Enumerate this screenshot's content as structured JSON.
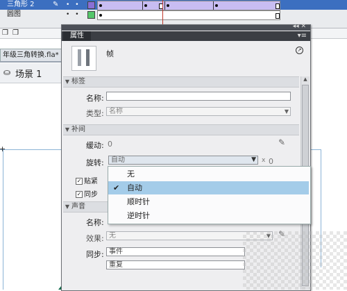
{
  "timeline": {
    "layers": [
      {
        "name": "三角形 2",
        "color": "#8a6fd6",
        "selected": true
      },
      {
        "name": "圆图",
        "color": "#55c76a",
        "selected": false
      }
    ]
  },
  "document": {
    "tab_label": "年级三角转换.fla*",
    "scene_label": "场景 1"
  },
  "panel": {
    "title": "属性",
    "frame_label": "帧",
    "sections": {
      "label": "标签",
      "tween": "补间",
      "sound": "声音"
    },
    "label_section": {
      "name_label": "名称:",
      "name_value": "",
      "type_label": "类型:",
      "type_value": "名称"
    },
    "tween_section": {
      "ease_label": "缓动:",
      "ease_value": "0",
      "rotate_label": "旋转:",
      "rotate_value": "自动",
      "rotate_times_prefix": "x",
      "rotate_times": "0",
      "snap_label": "贴紧",
      "sync_label": "同步"
    },
    "sound_section": {
      "name_label": "名称:",
      "effect_label": "效果:",
      "effect_value": "无",
      "sync_label": "同步:",
      "sync_value": "事件",
      "repeat_value": "重复"
    }
  },
  "rotate_menu": {
    "options": [
      "无",
      "自动",
      "顺时针",
      "逆时针"
    ],
    "selected": "自动"
  }
}
